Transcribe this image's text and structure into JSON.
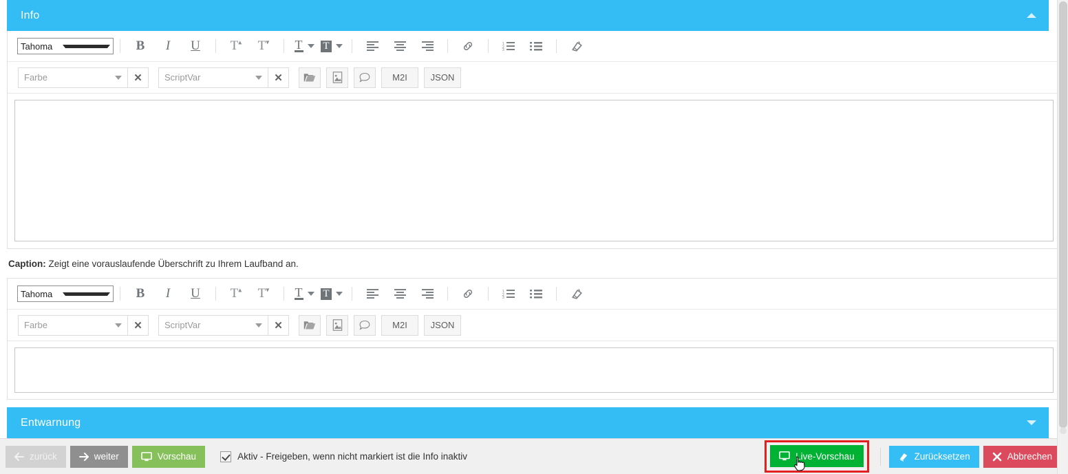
{
  "window": {
    "scrollbar_present": true
  },
  "colors": {
    "header_blue": "#34bdf5",
    "accent_green": "#00b233",
    "preview_green": "#86c05b",
    "reset_blue": "#35bdf5",
    "cancel_red": "#dc4a5d",
    "highlight_red": "#e41f1f",
    "footer_bg": "#f0f0f0"
  },
  "panels": {
    "info": {
      "title": "Info",
      "chevron": "chevron-up-icon",
      "expanded": true
    },
    "entwarnung": {
      "title": "Entwarnung",
      "chevron": "chevron-down-icon",
      "expanded": false
    }
  },
  "editor_toolbar": {
    "font_select": {
      "value": "Tahoma",
      "caret": "caret-down-icon"
    },
    "format_buttons": [
      {
        "name": "bold-button",
        "glyph": "B",
        "title": "Bold"
      },
      {
        "name": "italic-button",
        "glyph": "I",
        "title": "Italic"
      },
      {
        "name": "underline-button",
        "glyph": "U",
        "title": "Underline"
      },
      {
        "name": "superscript-button",
        "glyph": "T",
        "title": "Superscript"
      },
      {
        "name": "subscript-button",
        "glyph": "T",
        "title": "Subscript"
      }
    ],
    "color_button_label": "T",
    "highlight_button_label": "T",
    "align_buttons": [
      {
        "name": "align-left-button"
      },
      {
        "name": "align-center-button"
      },
      {
        "name": "align-right-button"
      }
    ],
    "link_button": "link-icon",
    "ordered_list_button": "ordered-list-icon",
    "unordered_list_button": "unordered-list-icon",
    "clear_format_button": "eraser-icon"
  },
  "editor_toolbar_row2": {
    "color_combo": {
      "placeholder": "Farbe",
      "value": "Farbe",
      "caret": "caret-down-icon",
      "clear": "clear-x-icon"
    },
    "scriptvar_combo": {
      "placeholder": "ScriptVar",
      "value": "ScriptVar",
      "caret": "caret-down-icon",
      "clear": "clear-x-icon"
    },
    "buttons": [
      {
        "name": "open-folder-button",
        "icon": "folder-open-icon",
        "label": ""
      },
      {
        "name": "insert-image-button",
        "icon": "image-icon",
        "label": ""
      },
      {
        "name": "comment-button",
        "icon": "speech-bubble-icon",
        "label": ""
      },
      {
        "name": "m2i-button",
        "icon": "",
        "label": "M2I"
      },
      {
        "name": "json-button",
        "icon": "",
        "label": "JSON"
      }
    ]
  },
  "caption": {
    "label": "Caption:",
    "text": "Zeigt eine vorauslaufende Überschrift zu Ihrem Laufband an."
  },
  "editors": {
    "top": {
      "name": "info-richtext-editor",
      "content": ""
    },
    "bottom": {
      "name": "caption-richtext-editor",
      "content": ""
    }
  },
  "footer": {
    "back_button": {
      "label": "zurück",
      "icon": "arrow-left-icon",
      "disabled": true
    },
    "next_button": {
      "label": "weiter",
      "icon": "arrow-right-icon",
      "disabled": false
    },
    "preview_button": {
      "label": "Vorschau",
      "icon": "monitor-icon"
    },
    "active_checkbox": {
      "checked": true,
      "label": "Aktiv - Freigeben, wenn nicht markiert ist die Info inaktiv"
    },
    "live_preview_button": {
      "label": "Live-Vorschau",
      "icon": "monitor-icon",
      "highlighted": true
    },
    "reset_button": {
      "label": "Zurücksetzen",
      "icon": "eraser-icon"
    },
    "cancel_button": {
      "label": "Abbrechen",
      "icon": "close-x-icon"
    }
  }
}
